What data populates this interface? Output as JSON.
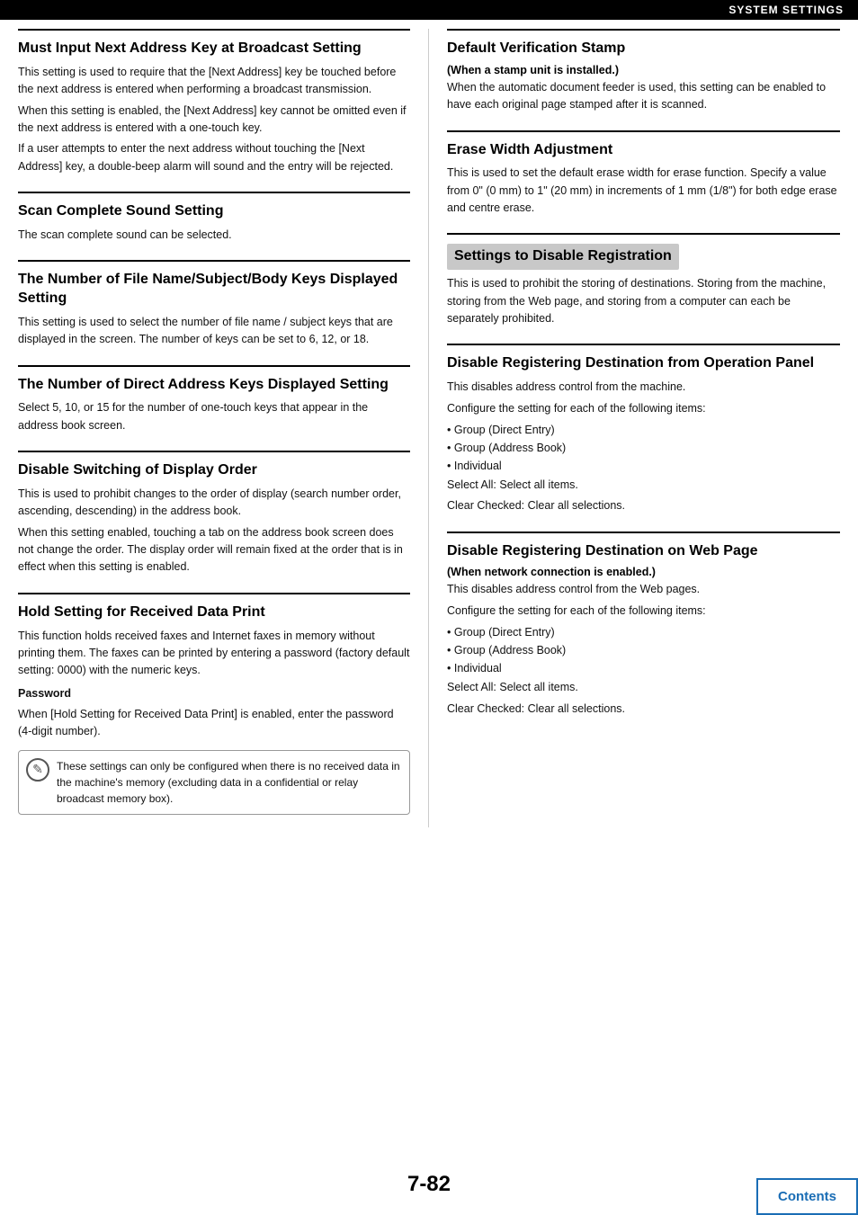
{
  "header": {
    "title": "SYSTEM SETTINGS"
  },
  "left_column": {
    "sections": [
      {
        "id": "must-input",
        "title": "Must Input Next Address Key at Broadcast Setting",
        "body": [
          "This setting is used to require that the [Next Address] key be touched before the next address is entered when performing a broadcast transmission.",
          "When this setting is enabled, the [Next Address] key cannot be omitted even if the next address is entered with a one-touch key.",
          "If a user attempts to enter the next address without touching the [Next Address] key, a double-beep alarm will sound and the entry will be rejected."
        ]
      },
      {
        "id": "scan-complete",
        "title": "Scan Complete Sound Setting",
        "body": [
          "The scan complete sound can be selected."
        ]
      },
      {
        "id": "file-name-keys",
        "title": "The Number of File Name/Subject/Body Keys Displayed Setting",
        "body": [
          "This setting is used to select the number of file name / subject keys that are displayed in the screen. The number of keys can be set to 6, 12, or 18."
        ]
      },
      {
        "id": "direct-address-keys",
        "title": "The Number of Direct Address Keys Displayed Setting",
        "body": [
          "Select 5, 10, or 15 for the number of one-touch keys that appear in the address book screen."
        ]
      },
      {
        "id": "disable-switching",
        "title": "Disable Switching of Display Order",
        "body": [
          "This is used to prohibit changes to the order of display (search number order, ascending, descending) in the address book.",
          "When this setting enabled, touching a tab on the address book screen does not change the order. The display order will remain fixed at the order that is in effect when this setting is enabled."
        ]
      },
      {
        "id": "hold-setting",
        "title": "Hold Setting for Received Data Print",
        "body": [
          "This function holds received faxes and Internet faxes in memory without printing them. The faxes can be printed by entering a password (factory default setting: 0000) with the numeric keys."
        ],
        "password_label": "Password",
        "password_body": "When [Hold Setting for Received Data Print] is enabled, enter the password (4-digit number).",
        "note": "These settings can only be configured when there is no received data in the machine's memory (excluding data in a confidential or relay broadcast memory box)."
      }
    ]
  },
  "right_column": {
    "sections": [
      {
        "id": "default-verification",
        "title": "Default Verification Stamp",
        "subtitle": "(When a stamp unit is installed.)",
        "body": [
          "When the automatic document feeder is used, this setting can be enabled to have each original page stamped after it is scanned."
        ]
      },
      {
        "id": "erase-width",
        "title": "Erase Width Adjustment",
        "body": [
          "This is used to set the default erase width for erase function. Specify a value from 0\" (0 mm) to 1\" (20 mm) in increments of 1 mm (1/8\") for both edge erase and centre erase."
        ]
      },
      {
        "id": "settings-disable",
        "title": "Settings to Disable Registration",
        "highlighted": true,
        "body": [
          "This is used to prohibit the storing of destinations. Storing from the machine, storing from the Web page, and storing from a computer can each be separately prohibited."
        ]
      },
      {
        "id": "disable-registering-op",
        "title": "Disable Registering Destination from Operation Panel",
        "body": [
          "This disables address control from the machine.",
          "Configure the setting for each of the following items:"
        ],
        "bullets": [
          "Group (Direct Entry)",
          "Group (Address Book)",
          "Individual"
        ],
        "extra": [
          "Select All: Select all items.",
          "Clear Checked: Clear all selections."
        ]
      },
      {
        "id": "disable-registering-web",
        "title": "Disable Registering Destination on Web Page",
        "subtitle": "(When network connection is enabled.)",
        "body": [
          "This disables address control from the Web pages.",
          "Configure the setting for each of the following items:"
        ],
        "bullets": [
          "Group (Direct Entry)",
          "Group (Address Book)",
          "Individual"
        ],
        "extra": [
          "Select All: Select all items.",
          "Clear Checked: Clear all selections."
        ]
      }
    ]
  },
  "footer": {
    "page_number": "7-82",
    "contents_label": "Contents"
  },
  "icons": {
    "note_icon": "✎"
  }
}
